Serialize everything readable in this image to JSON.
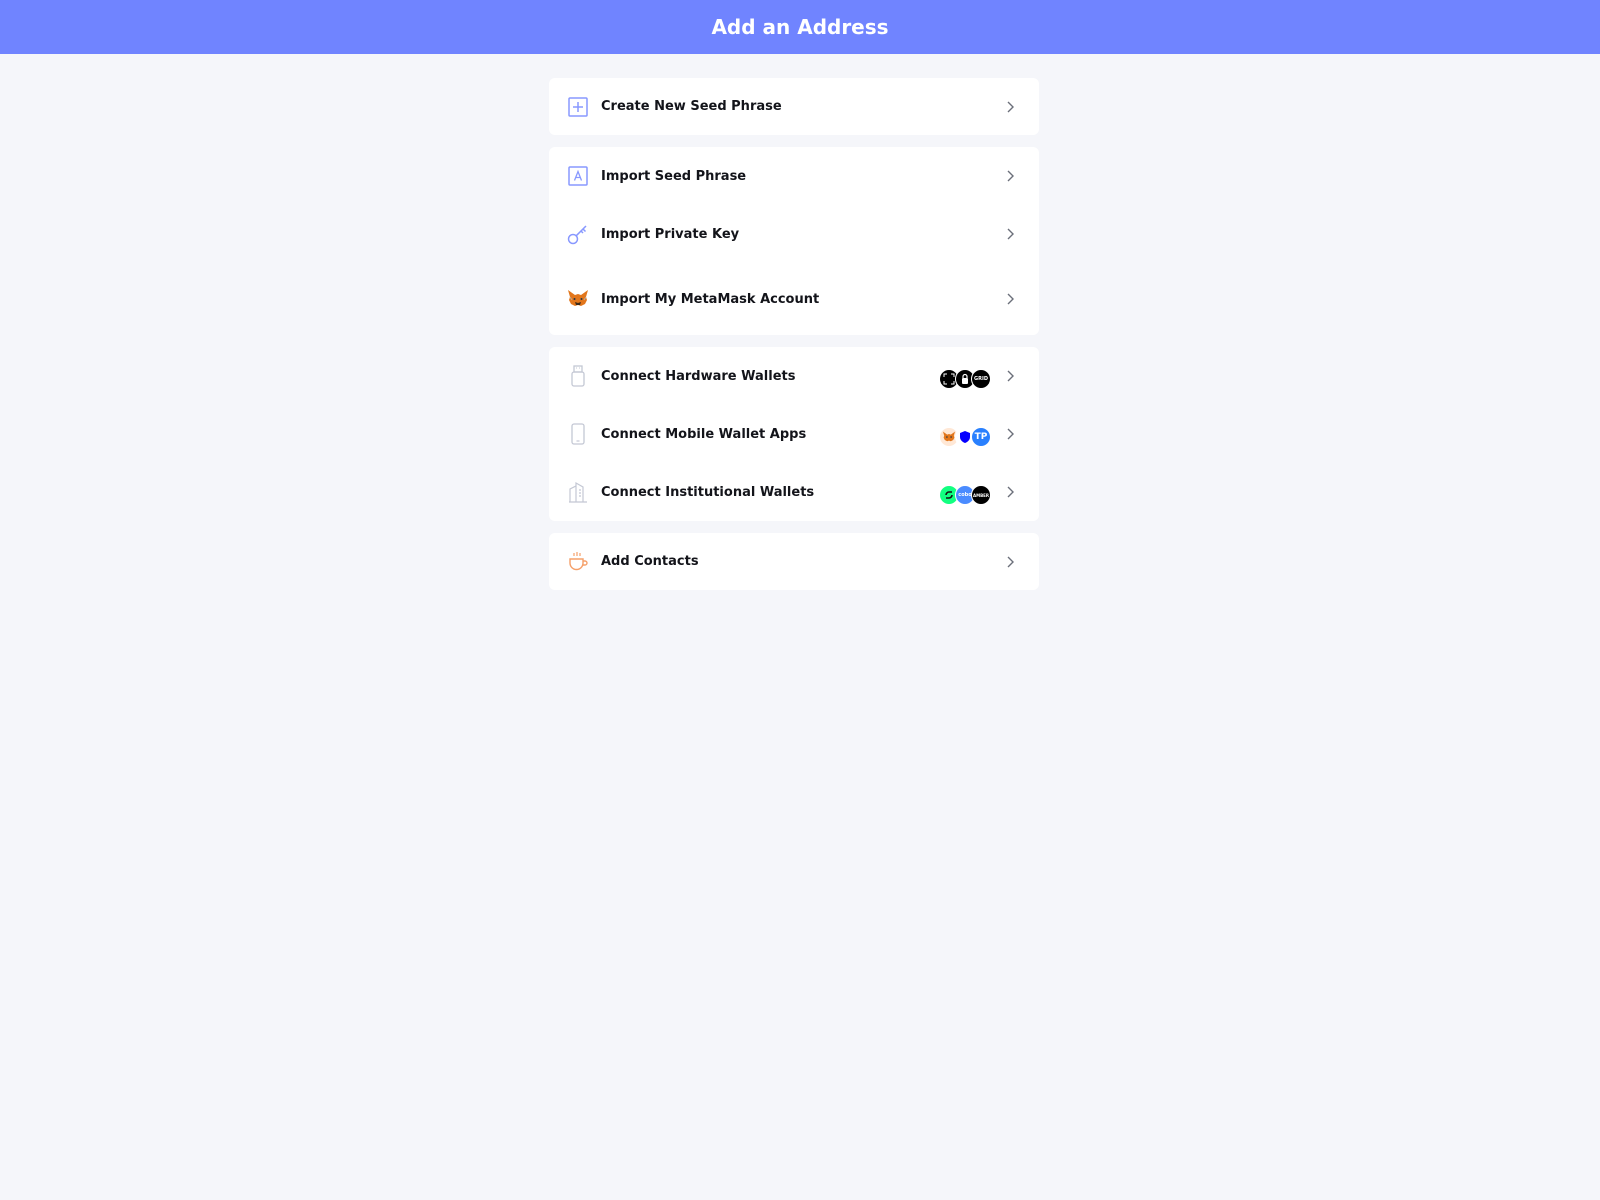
{
  "header": {
    "title": "Add an Address"
  },
  "groups": [
    {
      "items": [
        {
          "label": "Create New Seed Phrase",
          "icon": "plus-square-icon"
        }
      ]
    },
    {
      "items": [
        {
          "label": "Import Seed Phrase",
          "icon": "seed-phrase-icon"
        },
        {
          "label": "Import Private Key",
          "icon": "key-icon"
        },
        {
          "label": "Import My MetaMask Account",
          "icon": "metamask-fox-icon"
        }
      ]
    },
    {
      "items": [
        {
          "label": "Connect Hardware Wallets",
          "icon": "usb-drive-icon",
          "badges": [
            "ledger-logo",
            "keystone-logo",
            "grid-logo"
          ],
          "badge_text": "GRID"
        },
        {
          "label": "Connect Mobile Wallet Apps",
          "icon": "phone-icon",
          "badges": [
            "metamask-fox-logo",
            "trust-wallet-logo",
            "tokenpocket-logo"
          ],
          "badge_text": "TP"
        },
        {
          "label": "Connect Institutional Wallets",
          "icon": "building-icon",
          "badges": [
            "gnosis-safe-logo",
            "coboargus-logo",
            "amber-logo"
          ],
          "badge_text_1": "cobo",
          "badge_text_2": "AMBER"
        }
      ]
    },
    {
      "items": [
        {
          "label": "Add Contacts",
          "icon": "coffee-cup-icon"
        }
      ]
    }
  ],
  "colors": {
    "header": "#7084ff",
    "background": "#f5f6fa",
    "icon_blue": "#8898ff",
    "icon_gray": "#c4c8d4",
    "icon_orange": "#f5a06a"
  }
}
